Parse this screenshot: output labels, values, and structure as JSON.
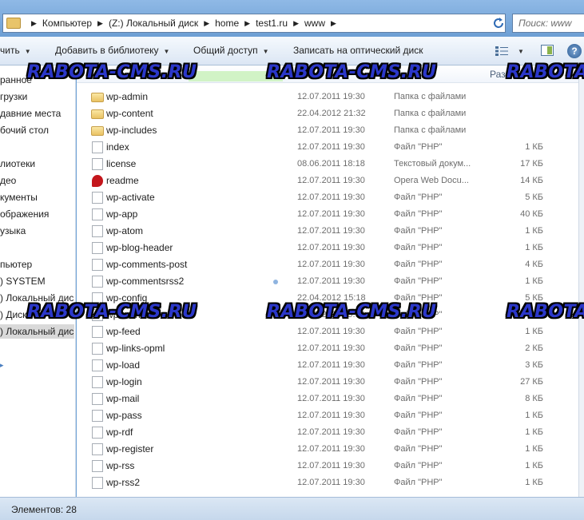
{
  "address": {
    "crumbs": [
      "Компьютер",
      "(Z:) Локальный диск",
      "home",
      "test1.ru",
      "www"
    ],
    "search_placeholder": "Поиск: www"
  },
  "toolbar": {
    "organize_label": "чить",
    "add_to_library_label": "Добавить в библиотеку",
    "share_label": "Общий доступ",
    "burn_label": "Записать на оптический диск",
    "help_label": "?"
  },
  "nav": {
    "items": [
      {
        "label": "ранное",
        "selected": false
      },
      {
        "label": "грузки",
        "selected": false
      },
      {
        "label": "давние места",
        "selected": false
      },
      {
        "label": "бочий стол",
        "selected": false
      },
      {
        "label": "лиотеки",
        "selected": false
      },
      {
        "label": "део",
        "selected": false
      },
      {
        "label": "кументы",
        "selected": false
      },
      {
        "label": "ображения",
        "selected": false
      },
      {
        "label": "узыка",
        "selected": false
      },
      {
        "label": "пьютер",
        "selected": false
      },
      {
        "label": ") SYSTEM",
        "selected": false
      },
      {
        "label": ") Локальный дис",
        "selected": false
      },
      {
        "label": ") Диск",
        "selected": false
      },
      {
        "label": ") Локальный дис",
        "selected": true
      }
    ]
  },
  "columns": {
    "size_header": "Раз"
  },
  "files": [
    {
      "name": "wp-admin",
      "date": "12.07.2011 19:30",
      "type": "Папка с файлами",
      "size": "",
      "icon": "folder"
    },
    {
      "name": "wp-content",
      "date": "22.04.2012 21:32",
      "type": "Папка с файлами",
      "size": "",
      "icon": "folder"
    },
    {
      "name": "wp-includes",
      "date": "12.07.2011 19:30",
      "type": "Папка с файлами",
      "size": "",
      "icon": "folder"
    },
    {
      "name": "index",
      "date": "12.07.2011 19:30",
      "type": "Файл \"PHP\"",
      "size": "1 КБ",
      "icon": "file"
    },
    {
      "name": "license",
      "date": "08.06.2011 18:18",
      "type": "Текстовый докум...",
      "size": "17 КБ",
      "icon": "file"
    },
    {
      "name": "readme",
      "date": "12.07.2011 19:30",
      "type": "Opera Web Docu...",
      "size": "14 КБ",
      "icon": "opera"
    },
    {
      "name": "wp-activate",
      "date": "12.07.2011 19:30",
      "type": "Файл \"PHP\"",
      "size": "5 КБ",
      "icon": "file"
    },
    {
      "name": "wp-app",
      "date": "12.07.2011 19:30",
      "type": "Файл \"PHP\"",
      "size": "40 КБ",
      "icon": "file"
    },
    {
      "name": "wp-atom",
      "date": "12.07.2011 19:30",
      "type": "Файл \"PHP\"",
      "size": "1 КБ",
      "icon": "file"
    },
    {
      "name": "wp-blog-header",
      "date": "12.07.2011 19:30",
      "type": "Файл \"PHP\"",
      "size": "1 КБ",
      "icon": "file"
    },
    {
      "name": "wp-comments-post",
      "date": "12.07.2011 19:30",
      "type": "Файл \"PHP\"",
      "size": "4 КБ",
      "icon": "file"
    },
    {
      "name": "wp-commentsrss2",
      "date": "12.07.2011 19:30",
      "type": "Файл \"PHP\"",
      "size": "1 КБ",
      "icon": "file"
    },
    {
      "name": "wp-config",
      "date": "22.04.2012 15:18",
      "type": "Файл \"PHP\"",
      "size": "5 КБ",
      "icon": "file"
    },
    {
      "name": "wp-cron",
      "date": "12.07.2011 19:30",
      "type": "Файл \"PHP\"",
      "size": "",
      "icon": "file"
    },
    {
      "name": "wp-feed",
      "date": "12.07.2011 19:30",
      "type": "Файл \"PHP\"",
      "size": "1 КБ",
      "icon": "file"
    },
    {
      "name": "wp-links-opml",
      "date": "12.07.2011 19:30",
      "type": "Файл \"PHP\"",
      "size": "2 КБ",
      "icon": "file"
    },
    {
      "name": "wp-load",
      "date": "12.07.2011 19:30",
      "type": "Файл \"PHP\"",
      "size": "3 КБ",
      "icon": "file"
    },
    {
      "name": "wp-login",
      "date": "12.07.2011 19:30",
      "type": "Файл \"PHP\"",
      "size": "27 КБ",
      "icon": "file"
    },
    {
      "name": "wp-mail",
      "date": "12.07.2011 19:30",
      "type": "Файл \"PHP\"",
      "size": "8 КБ",
      "icon": "file"
    },
    {
      "name": "wp-pass",
      "date": "12.07.2011 19:30",
      "type": "Файл \"PHP\"",
      "size": "1 КБ",
      "icon": "file"
    },
    {
      "name": "wp-rdf",
      "date": "12.07.2011 19:30",
      "type": "Файл \"PHP\"",
      "size": "1 КБ",
      "icon": "file"
    },
    {
      "name": "wp-register",
      "date": "12.07.2011 19:30",
      "type": "Файл \"PHP\"",
      "size": "1 КБ",
      "icon": "file"
    },
    {
      "name": "wp-rss",
      "date": "12.07.2011 19:30",
      "type": "Файл \"PHP\"",
      "size": "1 КБ",
      "icon": "file"
    },
    {
      "name": "wp-rss2",
      "date": "12.07.2011 19:30",
      "type": "Файл \"PHP\"",
      "size": "1 КБ",
      "icon": "file"
    }
  ],
  "status": {
    "items_label": "Элементов: 28"
  },
  "watermark": "RABOTA-CMS.RU"
}
